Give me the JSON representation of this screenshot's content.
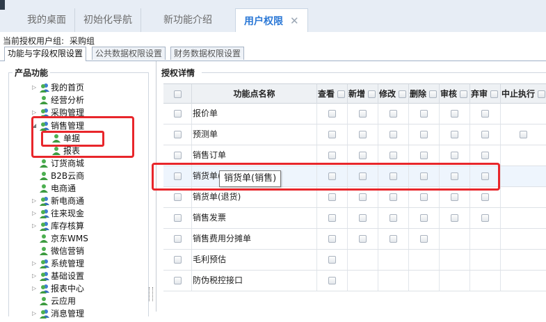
{
  "top_tabs": [
    {
      "label": "我的桌面"
    },
    {
      "label": "初始化导航"
    },
    {
      "label": "新功能介绍"
    },
    {
      "label": "用户权限"
    }
  ],
  "role": {
    "label": "当前授权用户组:",
    "value": "采购组"
  },
  "sub_tabs": [
    {
      "label": "功能与字段权限设置"
    },
    {
      "label": "公共数据权限设置"
    },
    {
      "label": "财务数据权限设置"
    }
  ],
  "left_panel": {
    "title": "产品功能",
    "tree": [
      {
        "label": "我的首页"
      },
      {
        "label": "经营分析"
      },
      {
        "label": "采购管理"
      },
      {
        "label": "销售管理"
      },
      {
        "label": "单据"
      },
      {
        "label": "报表"
      },
      {
        "label": "订货商城"
      },
      {
        "label": "B2B云商"
      },
      {
        "label": "电商通"
      },
      {
        "label": "新电商通"
      },
      {
        "label": "往来现金"
      },
      {
        "label": "库存核算"
      },
      {
        "label": "京东WMS"
      },
      {
        "label": "微信营销"
      },
      {
        "label": "系统管理"
      },
      {
        "label": "基础设置"
      },
      {
        "label": "报表中心"
      },
      {
        "label": "云应用"
      },
      {
        "label": "消息管理"
      }
    ]
  },
  "right_panel": {
    "title": "授权详情",
    "columns": {
      "name": "功能点名称",
      "view": "查看",
      "add": "新增",
      "edit": "修改",
      "delete": "删除",
      "audit": "审核",
      "abandon": "弃审",
      "stop": "中止执行"
    },
    "rows": [
      {
        "name": "报价单"
      },
      {
        "name": "预测单"
      },
      {
        "name": "销售订单"
      },
      {
        "name": "销货单(销售)"
      },
      {
        "name": "销货单(退货)"
      },
      {
        "name": "销售发票"
      },
      {
        "name": "销售费用分摊单"
      },
      {
        "name": "毛利预估"
      },
      {
        "name": "防伪税控接口"
      }
    ],
    "tooltip": "销货单(销售)"
  }
}
